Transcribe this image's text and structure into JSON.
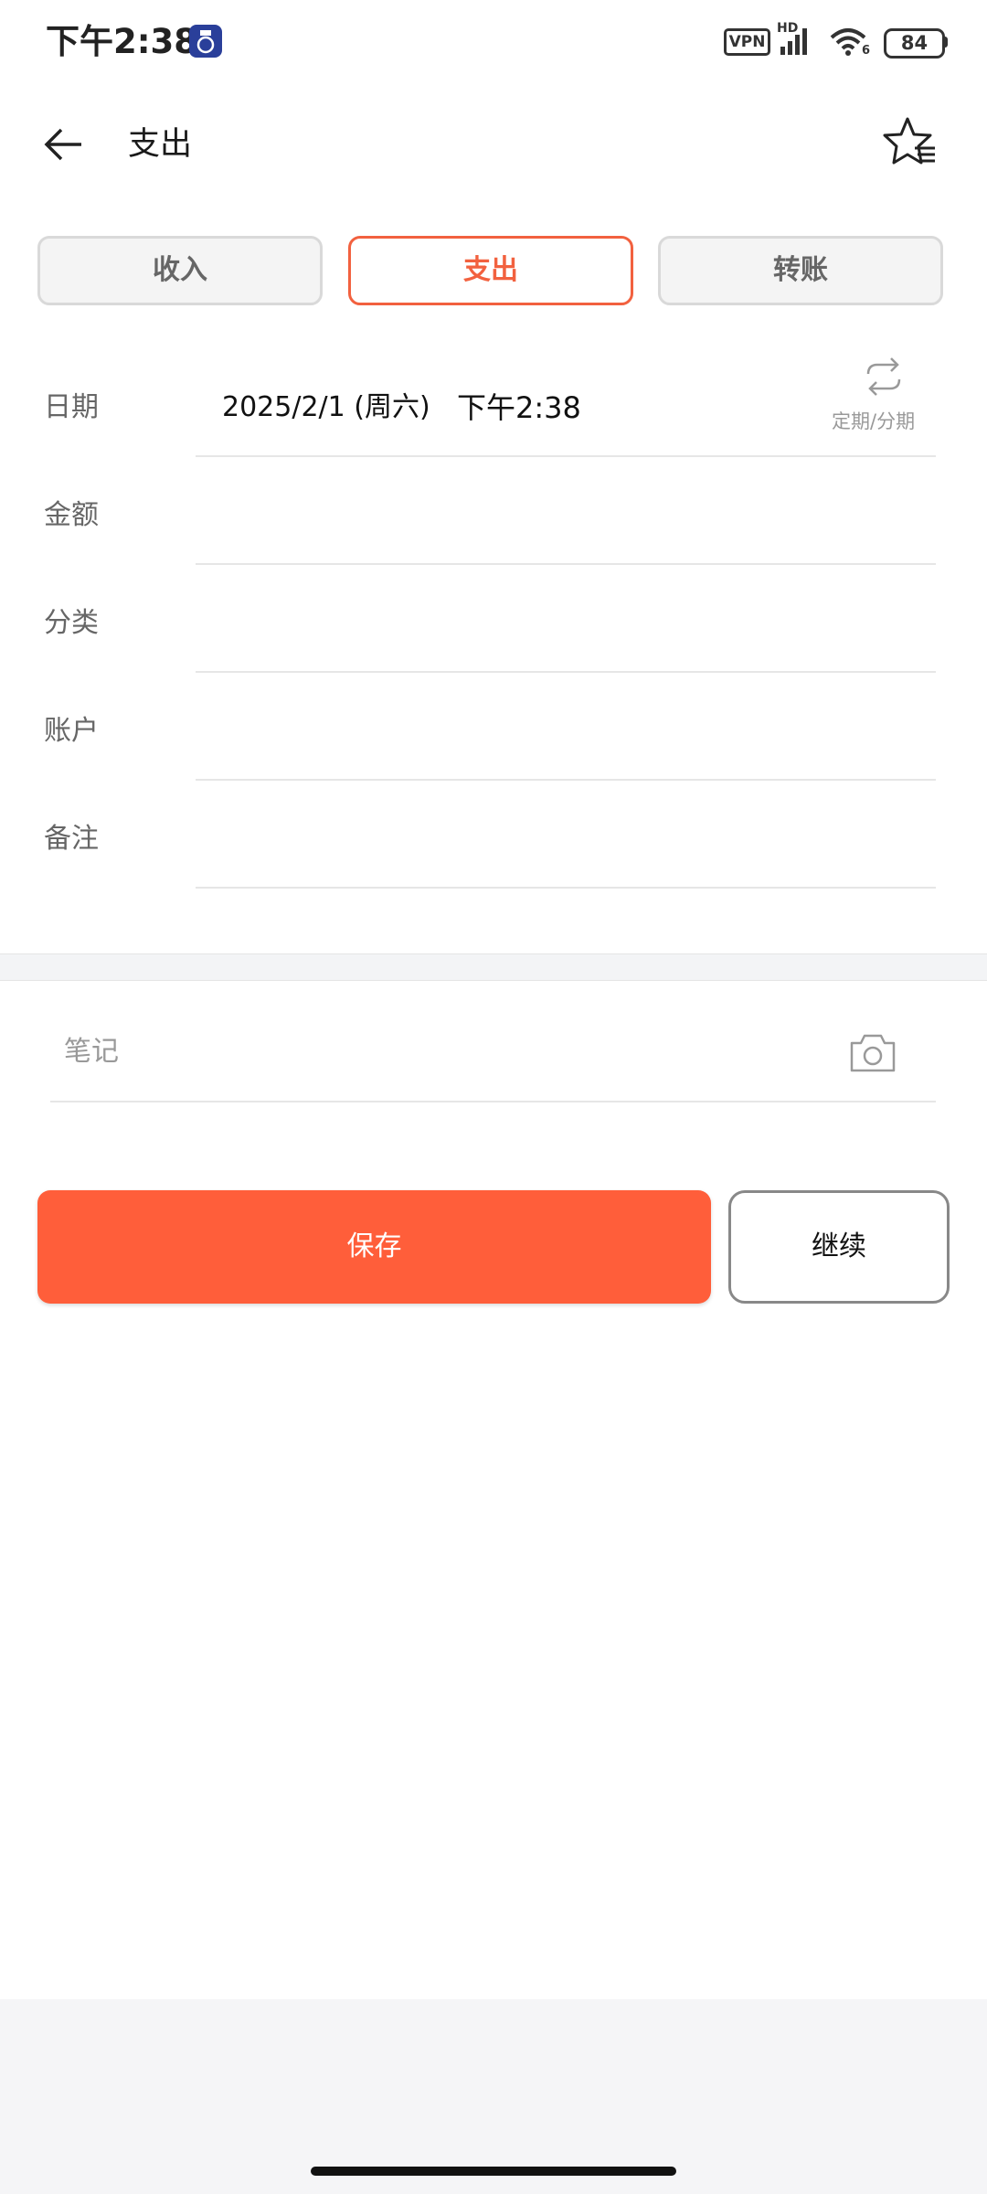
{
  "status_bar": {
    "time": "下午2:38",
    "vpn": "VPN",
    "hd": "HD",
    "wifi_badge": "6",
    "battery": "84"
  },
  "header": {
    "title": "支出",
    "back_icon": "arrow-left-icon",
    "favorite_icon": "star-list-icon"
  },
  "tabs": [
    {
      "label": "收入",
      "active": false
    },
    {
      "label": "支出",
      "active": true
    },
    {
      "label": "转账",
      "active": false
    }
  ],
  "form": {
    "date": {
      "label": "日期",
      "date_value": "2025/2/1 (周六)",
      "time_value": "下午2:38"
    },
    "recurring": {
      "label": "定期/分期",
      "icon": "repeat-icon"
    },
    "amount": {
      "label": "金额",
      "value": ""
    },
    "category": {
      "label": "分类",
      "value": ""
    },
    "account": {
      "label": "账户",
      "value": ""
    },
    "remark": {
      "label": "备注",
      "value": ""
    }
  },
  "note": {
    "placeholder": "笔记",
    "camera_icon": "camera-icon"
  },
  "actions": {
    "save_label": "保存",
    "continue_label": "继续"
  },
  "colors": {
    "accent": "#FF5E3A",
    "active_tab": "#F2613F",
    "label_gray": "#666666",
    "placeholder_gray": "#999999"
  }
}
